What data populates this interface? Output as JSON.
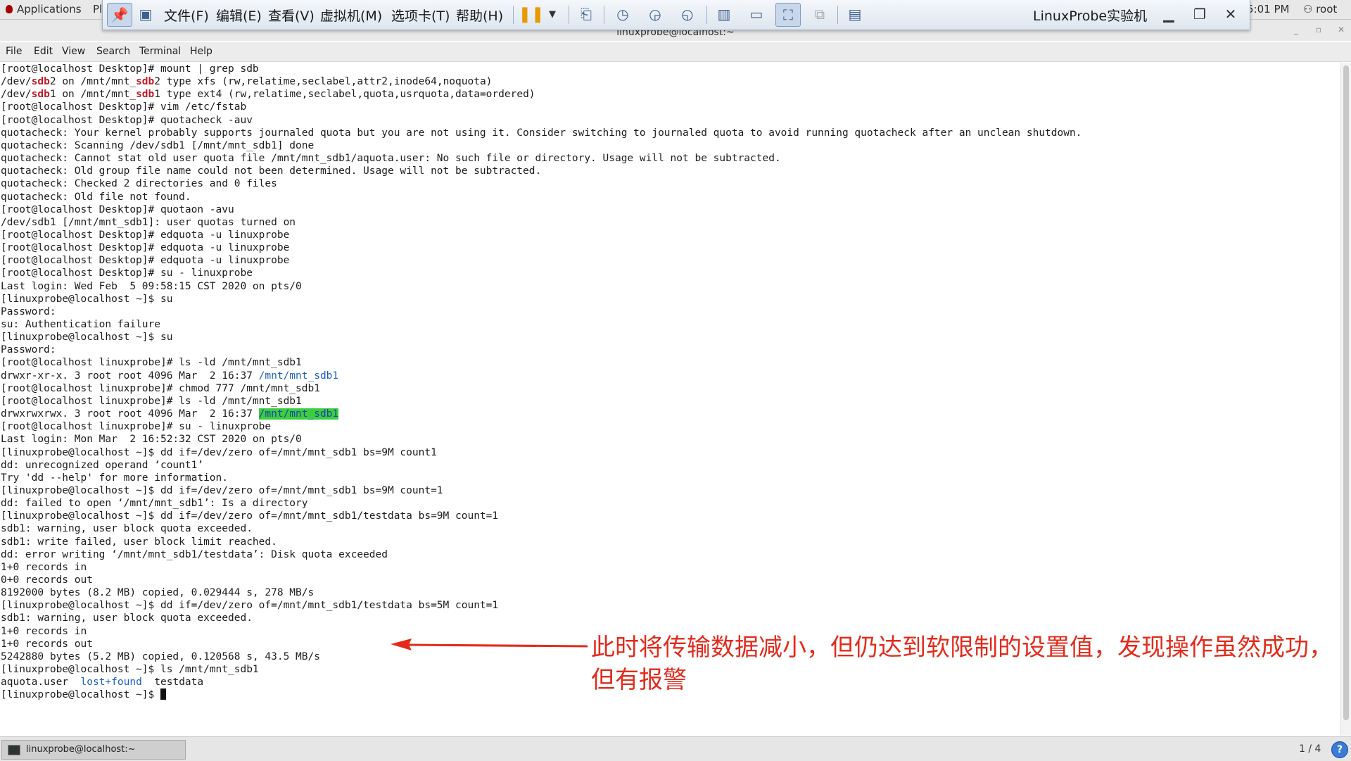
{
  "top_bar": {
    "applications": "Applications",
    "places_partial": "Pl",
    "clock_partial": "5:01 PM",
    "user": "root"
  },
  "vmware": {
    "menus": [
      "文件(F)",
      "编辑(E)",
      "查看(V)",
      "虚拟机(M)",
      "选项卡(T)",
      "帮助(H)"
    ],
    "title": "LinuxProbe实验机"
  },
  "terminal_window": {
    "title": "linuxprobe@localhost:~",
    "menus": [
      "File",
      "Edit",
      "View",
      "Search",
      "Terminal",
      "Help"
    ]
  },
  "terminal": {
    "lines": [
      "[root@localhost Desktop]# mount | grep sdb",
      "@L1",
      "@L2",
      "[root@localhost Desktop]# vim /etc/fstab",
      "[root@localhost Desktop]# quotacheck -auv",
      "quotacheck: Your kernel probably supports journaled quota but you are not using it. Consider switching to journaled quota to avoid running quotacheck after an unclean shutdown.",
      "quotacheck: Scanning /dev/sdb1 [/mnt/mnt_sdb1] done",
      "quotacheck: Cannot stat old user quota file /mnt/mnt_sdb1/aquota.user: No such file or directory. Usage will not be subtracted.",
      "quotacheck: Old group file name could not been determined. Usage will not be subtracted.",
      "quotacheck: Checked 2 directories and 0 files",
      "quotacheck: Old file not found.",
      "[root@localhost Desktop]# quotaon -avu",
      "/dev/sdb1 [/mnt/mnt_sdb1]: user quotas turned on",
      "[root@localhost Desktop]# edquota -u linuxprobe",
      "[root@localhost Desktop]# edquota -u linuxprobe",
      "[root@localhost Desktop]# edquota -u linuxprobe",
      "[root@localhost Desktop]# su - linuxprobe",
      "Last login: Wed Feb  5 09:58:15 CST 2020 on pts/0",
      "[linuxprobe@localhost ~]$ su",
      "Password:",
      "su: Authentication failure",
      "[linuxprobe@localhost ~]$ su",
      "Password:",
      "[root@localhost linuxprobe]# ls -ld /mnt/mnt_sdb1",
      "@L24",
      "[root@localhost linuxprobe]# chmod 777 /mnt/mnt_sdb1",
      "[root@localhost linuxprobe]# ls -ld /mnt/mnt_sdb1",
      "@L27",
      "[root@localhost linuxprobe]# su - linuxprobe",
      "Last login: Mon Mar  2 16:52:32 CST 2020 on pts/0",
      "[linuxprobe@localhost ~]$ dd if=/dev/zero of=/mnt/mnt_sdb1 bs=9M count1",
      "dd: unrecognized operand ‘count1’",
      "Try 'dd --help' for more information.",
      "[linuxprobe@localhost ~]$ dd if=/dev/zero of=/mnt/mnt_sdb1 bs=9M count=1",
      "dd: failed to open ‘/mnt/mnt_sdb1’: Is a directory",
      "[linuxprobe@localhost ~]$ dd if=/dev/zero of=/mnt/mnt_sdb1/testdata bs=9M count=1",
      "sdb1: warning, user block quota exceeded.",
      "sdb1: write failed, user block limit reached.",
      "dd: error writing ‘/mnt/mnt_sdb1/testdata’: Disk quota exceeded",
      "1+0 records in",
      "0+0 records out",
      "8192000 bytes (8.2 MB) copied, 0.029444 s, 278 MB/s",
      "[linuxprobe@localhost ~]$ dd if=/dev/zero of=/mnt/mnt_sdb1/testdata bs=5M count=1",
      "sdb1: warning, user block quota exceeded.",
      "1+0 records in",
      "1+0 records out",
      "5242880 bytes (5.2 MB) copied, 0.120568 s, 43.5 MB/s",
      "[linuxprobe@localhost ~]$ ls /mnt/mnt_sdb1",
      "@L48",
      "@L49"
    ],
    "rich": {
      "L1": [
        "/dev/",
        "sdb",
        "2 on /mnt/mnt_",
        "sdb",
        "2 type xfs (rw,relatime,seclabel,attr2,inode64,noquota)"
      ],
      "L2": [
        "/dev/",
        "sdb",
        "1 on /mnt/mnt_",
        "sdb",
        "1 type ext4 (rw,relatime,seclabel,quota,usrquota,data=ordered)"
      ],
      "L24": [
        "drwxr-xr-x. 3 root root 4096 Mar  2 16:37 ",
        "/mnt/mnt_sdb1"
      ],
      "L27": [
        "drwxrwxrwx. 3 root root 4096 Mar  2 16:37 ",
        "/mnt/mnt_sdb1"
      ],
      "L48": [
        "aquota.user  ",
        "lost+found",
        "  testdata"
      ],
      "L49": [
        "[linuxprobe@localhost ~]$ "
      ]
    }
  },
  "annotation": {
    "text": "此时将传输数据减小，但仍达到软限制的设置值，发现操作虽然成功，但有报警",
    "color": "#e32b1c"
  },
  "bottom_panel": {
    "task": "linuxprobe@localhost:~",
    "workspace": "1 / 4"
  },
  "colors": {
    "highlight_red": "#c01c28",
    "directory_blue": "#1f5fbf",
    "selection_green": "#3bcf3b"
  }
}
